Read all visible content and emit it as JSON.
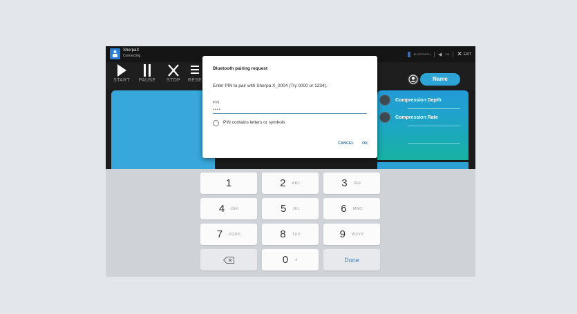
{
  "app": {
    "name": "SherpaX",
    "status": "Connecting"
  },
  "statusbar": {
    "connection": "BLUETOOTH",
    "sound": "ON",
    "exit": "EXIT"
  },
  "toolbar": {
    "start": "START",
    "pause": "PAUSE",
    "stop": "STOP",
    "reset": "RESE"
  },
  "user": {
    "name": "Name"
  },
  "metrics": [
    {
      "label": "Compression Depth"
    },
    {
      "label": "Compression Rate"
    }
  ],
  "dialog": {
    "title": "Bluetooth pairing request",
    "message": "Enter PIN to pair with Sherpa X_0004 (Try 0000 or 1234).",
    "pin_label": "PIN",
    "pin_value": "••••",
    "option_label": "PIN contains letters or symbols",
    "cancel": "CANCEL",
    "ok": "OK"
  },
  "keypad": {
    "keys": [
      {
        "digit": "1",
        "letters": ""
      },
      {
        "digit": "2",
        "letters": "ABC"
      },
      {
        "digit": "3",
        "letters": "DEF"
      },
      {
        "digit": "4",
        "letters": "GHI"
      },
      {
        "digit": "5",
        "letters": "JKL"
      },
      {
        "digit": "6",
        "letters": "MNO"
      },
      {
        "digit": "7",
        "letters": "PQRS"
      },
      {
        "digit": "8",
        "letters": "TUV"
      },
      {
        "digit": "9",
        "letters": "WXYZ"
      }
    ],
    "zero": "0",
    "plus": "+",
    "done": "Done",
    "backspace_icon": "backspace-icon"
  },
  "colors": {
    "accent": "#2ea3d6",
    "dialog_button": "#2f79b6",
    "keyboard_bg": "#cfd3d8"
  }
}
